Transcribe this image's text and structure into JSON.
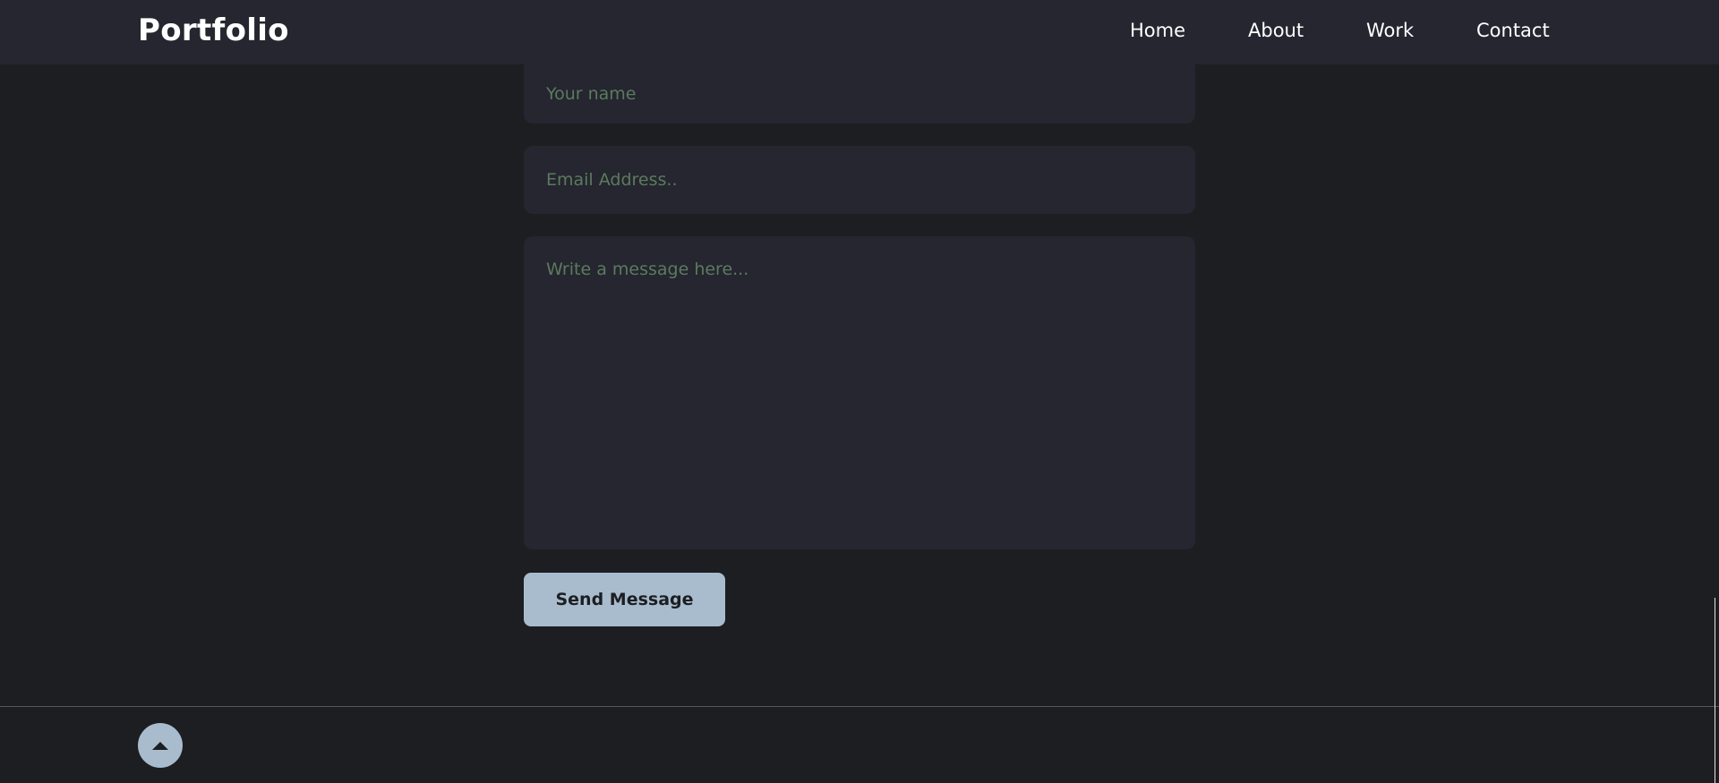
{
  "header": {
    "logo": "Portfolio",
    "nav": [
      "Home",
      "About",
      "Work",
      "Contact"
    ]
  },
  "form": {
    "name_placeholder": "Your name",
    "email_placeholder": "Email Address..",
    "message_placeholder": "Write a message here...",
    "submit_label": "Send Message"
  },
  "footer": {
    "to_top_icon": "arrow-up-icon"
  },
  "colors": {
    "background": "#1d1e22",
    "surface": "#25262f",
    "accent": "#a8bccd",
    "placeholder": "#5c7a60"
  }
}
